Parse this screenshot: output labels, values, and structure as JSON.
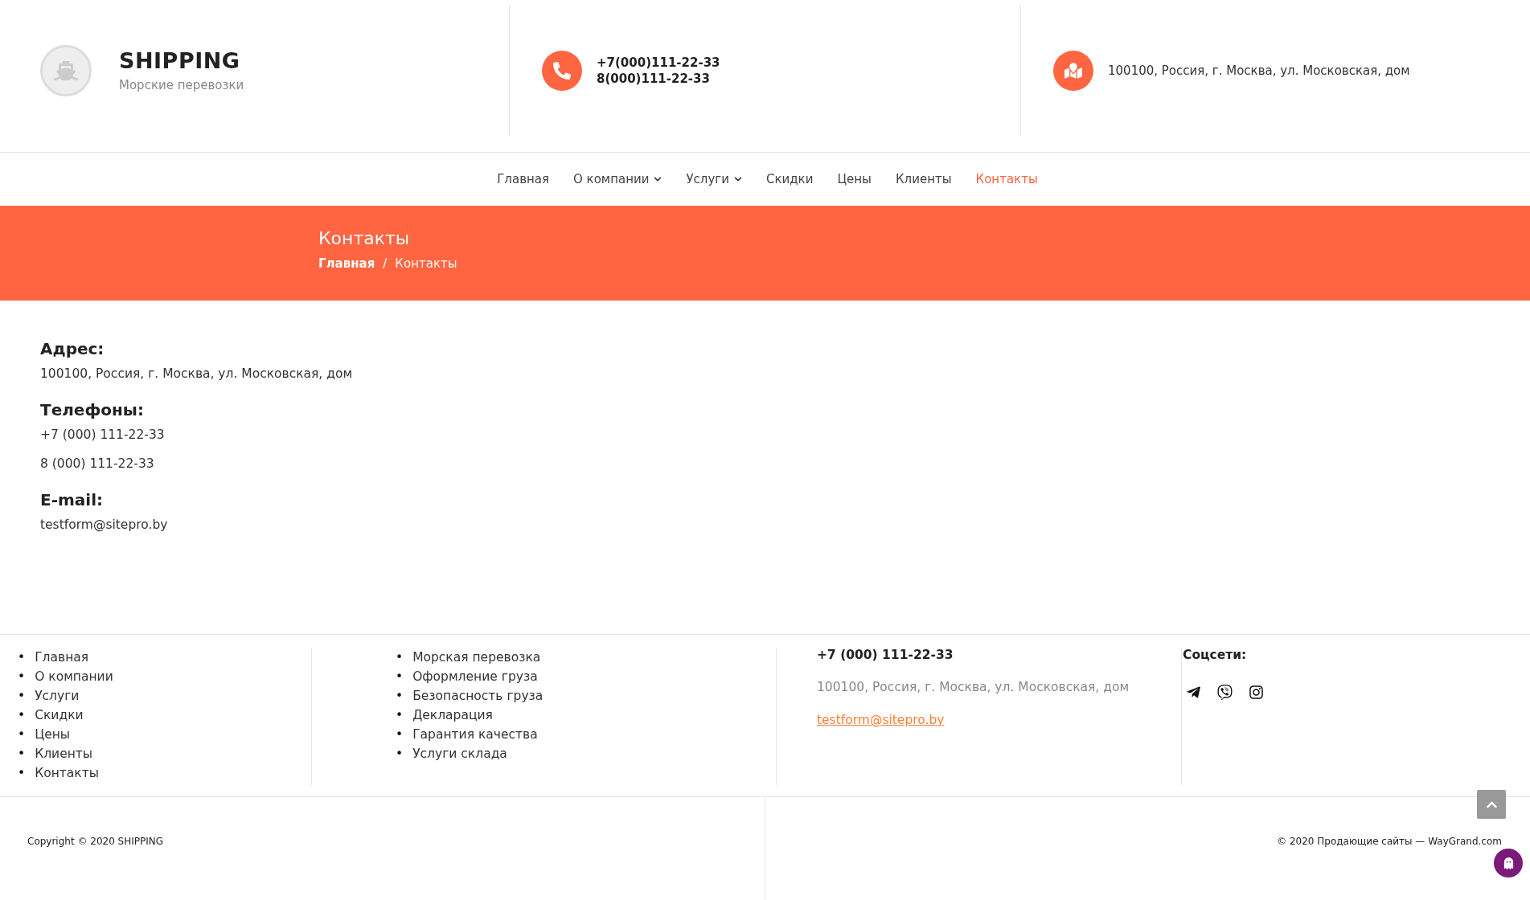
{
  "header": {
    "logo_title": "SHIPPING",
    "logo_subtitle": "Морские перевозки",
    "phones": [
      "+7(000)111-22-33",
      "8(000)111-22-33"
    ],
    "address": "100100, Россия, г. Москва, ул. Московская, дом"
  },
  "nav": [
    {
      "label": "Главная",
      "dropdown": false,
      "selected": false
    },
    {
      "label": "О компании",
      "dropdown": true,
      "selected": false
    },
    {
      "label": "Услуги",
      "dropdown": true,
      "selected": false
    },
    {
      "label": "Скидки",
      "dropdown": false,
      "selected": false
    },
    {
      "label": "Цены",
      "dropdown": false,
      "selected": false
    },
    {
      "label": "Клиенты",
      "dropdown": false,
      "selected": false
    },
    {
      "label": "Контакты",
      "dropdown": false,
      "selected": true
    }
  ],
  "banner": {
    "title": "Контакты",
    "breadcrumbs": [
      "Главная",
      "Контакты"
    ],
    "separators": [
      "/"
    ]
  },
  "contacts": [
    {
      "heading": "Адрес:",
      "lines": [
        "100100, Россия, г. Москва, ул. Московская, дом"
      ]
    },
    {
      "heading": "Телефоны:",
      "lines": [
        "+7 (000) 111-22-33",
        "8 (000) 111-22-33"
      ]
    },
    {
      "heading": "E-mail:",
      "lines": [
        "testform@sitepro.by"
      ]
    }
  ],
  "footer": {
    "menu": [
      {
        "bullet": "•",
        "label": "Главная"
      },
      {
        "bullet": "•",
        "label": "О компании"
      },
      {
        "bullet": "•",
        "label": "Услуги"
      },
      {
        "bullet": "•",
        "label": "Скидки"
      },
      {
        "bullet": "•",
        "label": "Цены"
      },
      {
        "bullet": "•",
        "label": "Клиенты"
      },
      {
        "bullet": "•",
        "label": "Контакты"
      }
    ],
    "services": [
      {
        "bullet": "•",
        "label": "Морская перевозка"
      },
      {
        "bullet": "•",
        "label": "Оформление груза"
      },
      {
        "bullet": "•",
        "label": "Безопасность груза"
      },
      {
        "bullet": "•",
        "label": "Декларация"
      },
      {
        "bullet": "•",
        "label": "Гарантия качества"
      },
      {
        "bullet": "•",
        "label": "Услуги склада"
      }
    ],
    "phone": "+7 (000) 111-22-33",
    "address": "100100, Россия, г. Москва, ул. Московская, дом",
    "email": "testform@sitepro.by",
    "social_title": "Соцсети:",
    "copyright": "Copyright © 2020 SHIPPING",
    "credit": "© 2020 Продающие сайты — WayGrand.com"
  }
}
